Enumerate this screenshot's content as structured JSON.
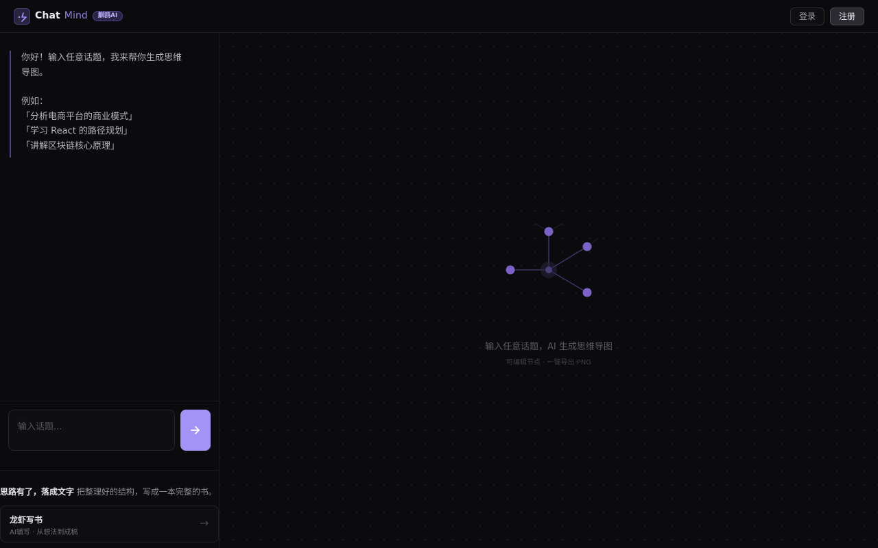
{
  "header": {
    "brand_part1": "Chat",
    "brand_part2": "Mind",
    "badge": "麒鸥AI",
    "login_label": "登录",
    "signup_label": "注册"
  },
  "sidebar": {
    "welcome": {
      "greeting_line1": "你好！输入任意话题，我来帮你生成思维",
      "greeting_line2": "导图。",
      "examples_heading": "例如：",
      "examples": [
        "「分析电商平台的商业模式」",
        "「学习 React 的路径规划」",
        "「讲解区块链核心原理」"
      ]
    },
    "input": {
      "placeholder": "输入话题..."
    },
    "promo": {
      "text_strong": "思路有了，落成文字",
      "text_rest": " 把整理好的结构，写成一本完整的书。",
      "card_title": "龙虾写书",
      "card_subtitle": "AI辅写 · 从想法到成稿",
      "card_arrow": "→"
    }
  },
  "canvas": {
    "empty_title": "输入任意话题，AI 生成思维导图",
    "empty_subtitle": "可编辑节点 · 一键导出 PNG"
  },
  "colors": {
    "accent": "#a393f7",
    "node": "#7a62c7",
    "background": "#0b0b0d"
  },
  "icons": {
    "logo": "sparkle-icon",
    "send": "arrow-right-icon"
  }
}
